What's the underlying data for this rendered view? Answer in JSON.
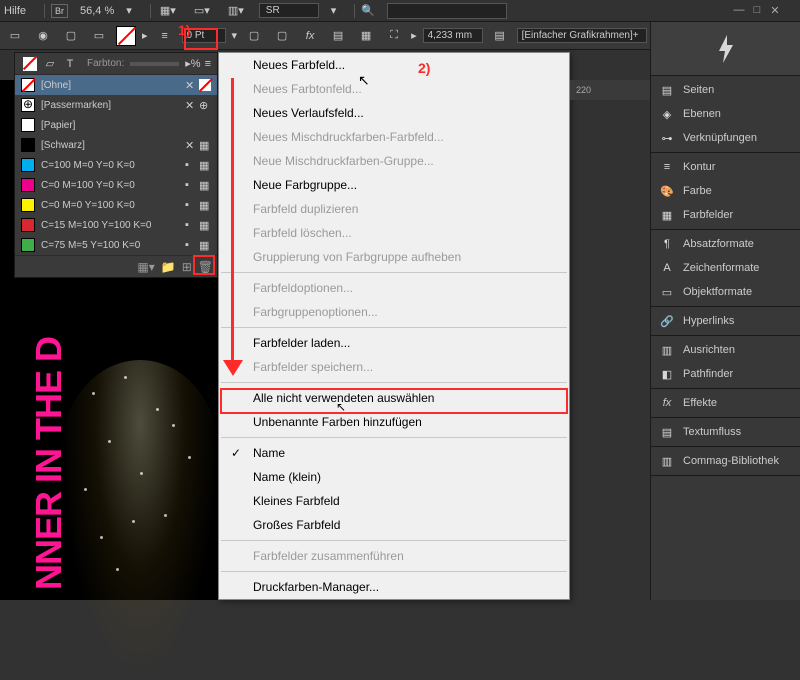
{
  "topbar": {
    "menu_help": "Hilfe",
    "br": "Br",
    "zoom": "56,4 %",
    "sr": "SR"
  },
  "ctrlbar": {
    "pt_value": "0 Pt",
    "mm_value": "4,233 mm",
    "frame_dropdown": "[Einfacher Grafikrahmen]+"
  },
  "annotations": {
    "a1": "1)",
    "a2": "2)"
  },
  "swatches": {
    "farbton_label": "Farbton:",
    "rows": [
      {
        "name": "[Ohne]"
      },
      {
        "name": "[Passermarken]"
      },
      {
        "name": "[Papier]"
      },
      {
        "name": "[Schwarz]"
      },
      {
        "name": "C=100 M=0 Y=0 K=0"
      },
      {
        "name": "C=0 M=100 Y=0 K=0"
      },
      {
        "name": "C=0 M=0 Y=100 K=0"
      },
      {
        "name": "C=15 M=100 Y=100 K=0"
      },
      {
        "name": "C=75 M=5 Y=100 K=0"
      }
    ]
  },
  "canvas": {
    "pink_text": "NNER IN THE D"
  },
  "flyout": {
    "items": [
      {
        "label": "Neues Farbfeld...",
        "enabled": true
      },
      {
        "label": "Neues Farbtonfeld...",
        "enabled": false
      },
      {
        "label": "Neues Verlaufsfeld...",
        "enabled": true
      },
      {
        "label": "Neues Mischdruckfarben-Farbfeld...",
        "enabled": false
      },
      {
        "label": "Neue Mischdruckfarben-Gruppe...",
        "enabled": false
      },
      {
        "label": "Neue Farbgruppe...",
        "enabled": true
      },
      {
        "label": "Farbfeld duplizieren",
        "enabled": false
      },
      {
        "label": "Farbfeld löschen...",
        "enabled": false
      },
      {
        "label": "Gruppierung von Farbgruppe aufheben",
        "enabled": false
      },
      {
        "label": "Farbfeldoptionen...",
        "enabled": false
      },
      {
        "label": "Farbgruppenoptionen...",
        "enabled": false
      },
      {
        "label": "Farbfelder laden...",
        "enabled": true
      },
      {
        "label": "Farbfelder speichern...",
        "enabled": false
      },
      {
        "label": "Alle nicht verwendeten auswählen",
        "enabled": true
      },
      {
        "label": "Unbenannte Farben hinzufügen",
        "enabled": true
      },
      {
        "label": "Name",
        "enabled": true,
        "checked": true
      },
      {
        "label": "Name (klein)",
        "enabled": true
      },
      {
        "label": "Kleines Farbfeld",
        "enabled": true
      },
      {
        "label": "Großes Farbfeld",
        "enabled": true
      },
      {
        "label": "Farbfelder zusammenführen",
        "enabled": false
      },
      {
        "label": "Druckfarben-Manager...",
        "enabled": true
      }
    ]
  },
  "ruler": {
    "tick": "220"
  },
  "rcol": {
    "g1": [
      {
        "label": "Seiten",
        "icon": "pages"
      },
      {
        "label": "Ebenen",
        "icon": "layers"
      },
      {
        "label": "Verknüpfungen",
        "icon": "links"
      }
    ],
    "g2": [
      {
        "label": "Kontur",
        "icon": "stroke"
      },
      {
        "label": "Farbe",
        "icon": "color"
      },
      {
        "label": "Farbfelder",
        "icon": "swatches"
      }
    ],
    "g3": [
      {
        "label": "Absatzformate",
        "icon": "para"
      },
      {
        "label": "Zeichenformate",
        "icon": "char"
      },
      {
        "label": "Objektformate",
        "icon": "obj"
      }
    ],
    "g4": [
      {
        "label": "Hyperlinks",
        "icon": "link"
      }
    ],
    "g5": [
      {
        "label": "Ausrichten",
        "icon": "align"
      },
      {
        "label": "Pathfinder",
        "icon": "path"
      }
    ],
    "g6": [
      {
        "label": "Effekte",
        "icon": "fx"
      }
    ],
    "g7": [
      {
        "label": "Textumfluss",
        "icon": "wrap"
      }
    ],
    "g8": [
      {
        "label": "Commag-Bibliothek",
        "icon": "lib"
      }
    ]
  }
}
